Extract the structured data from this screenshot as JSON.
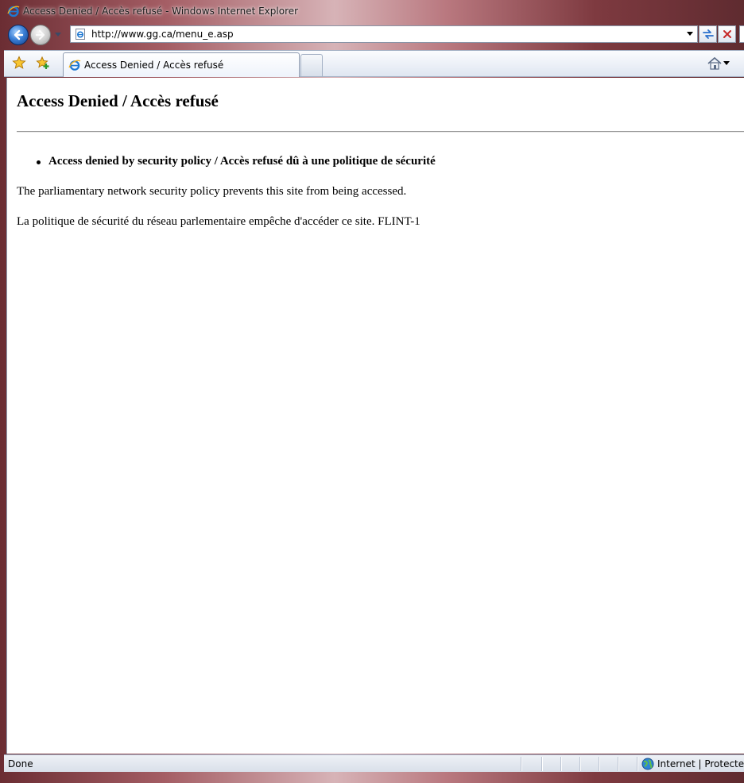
{
  "window": {
    "title": "Access Denied / Accès refusé - Windows Internet Explorer"
  },
  "toolbar": {
    "url": "http://www.gg.ca/menu_e.asp"
  },
  "tabs": [
    {
      "label": "Access Denied / Accès refusé",
      "active": true
    }
  ],
  "page": {
    "heading": "Access Denied / Accès refusé",
    "bullet": "Access denied by security policy / Accès refusé dû à une politique de sécurité",
    "paragraph_en": "The parliamentary network security policy prevents this site from being accessed.",
    "paragraph_fr": "La politique de sécurité du réseau parlementaire empêche d'accéder ce site. FLINT-1"
  },
  "statusbar": {
    "status": "Done",
    "zone": "Internet | Protected Mode: On"
  },
  "icons": {
    "app": "ie-logo-icon",
    "back": "back-arrow-icon",
    "forward": "forward-arrow-icon",
    "favorites": "favorites-star-icon",
    "add_favorites": "add-favorites-icon",
    "home": "home-icon",
    "refresh": "refresh-icon",
    "stop": "stop-icon",
    "zone": "globe-icon"
  },
  "colors": {
    "window_frame": "#a45d64",
    "nav_blue": "#3a7fd6",
    "stop_red": "#c62828"
  }
}
